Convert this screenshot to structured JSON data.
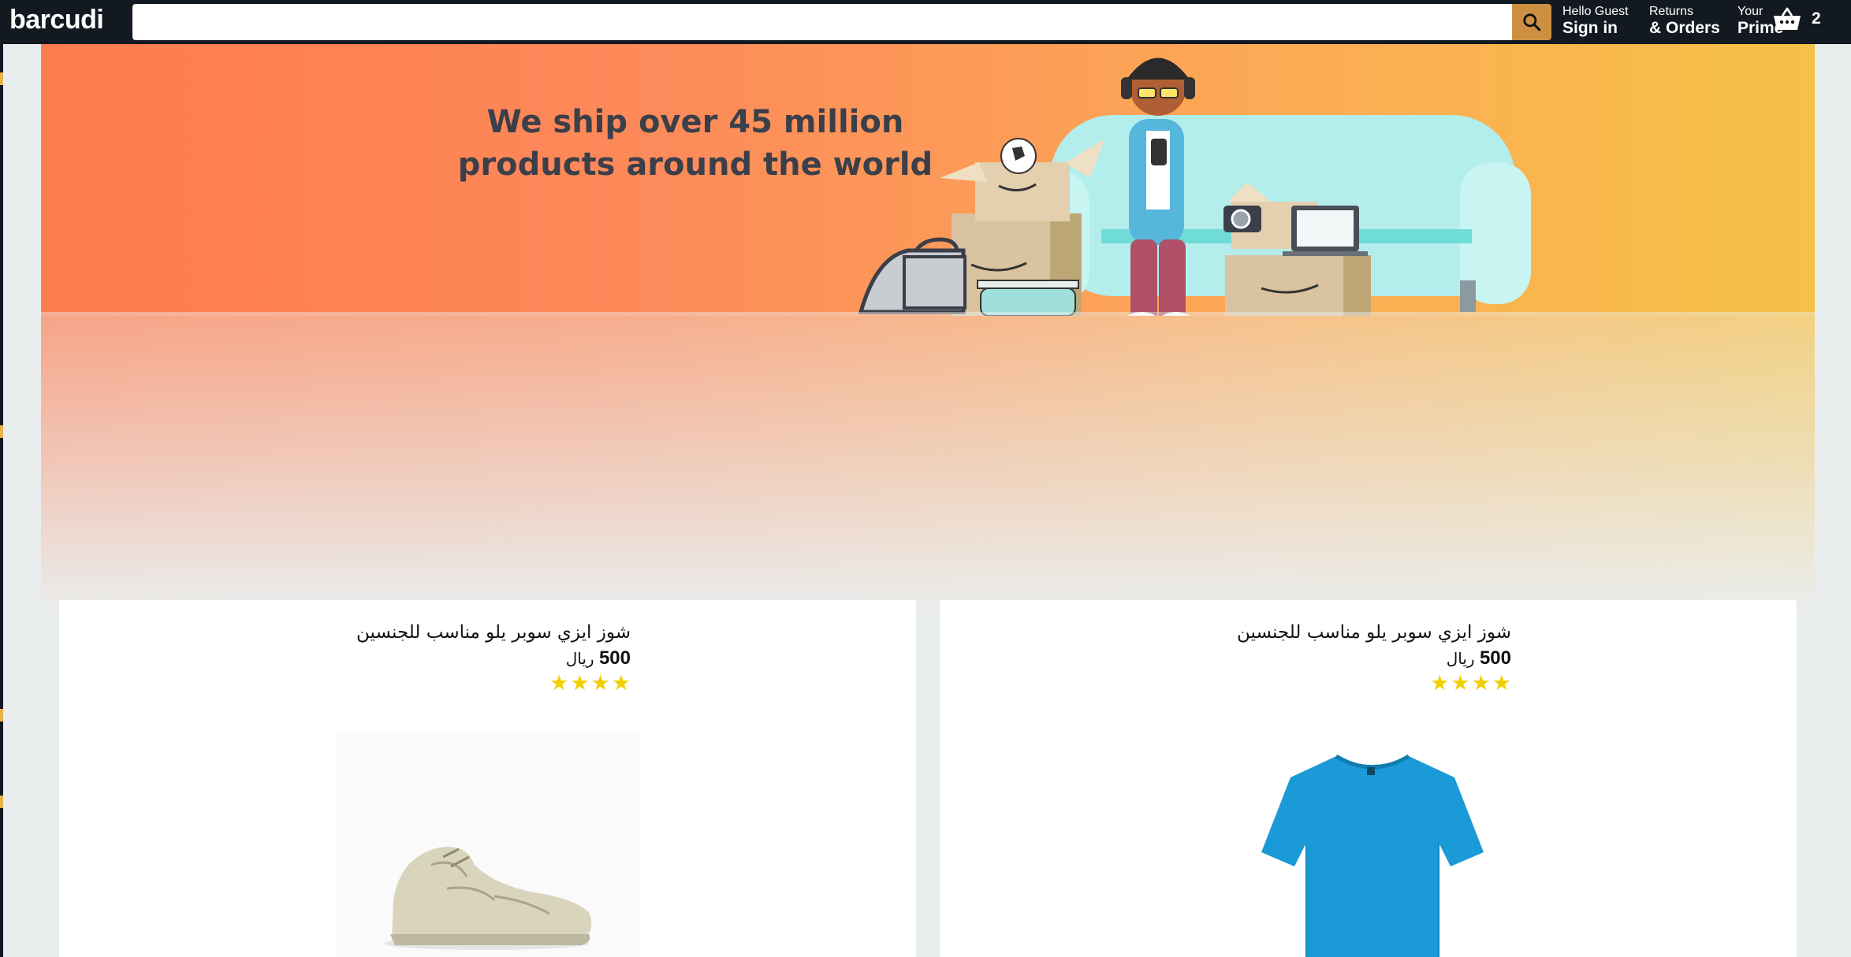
{
  "header": {
    "logo": "barcudi",
    "search": {
      "value": "",
      "placeholder": ""
    },
    "account": {
      "greeting": "Hello Guest",
      "action": "Sign in"
    },
    "orders": {
      "line1": "Returns",
      "line2": "& Orders"
    },
    "prime": {
      "line1": "Your",
      "line2": "Prime"
    },
    "cart": {
      "count": "2"
    }
  },
  "hero": {
    "headline_line1": "We ship over 45 million",
    "headline_line2": "products around the world"
  },
  "products": [
    {
      "title": "شوز ايزي سوبر يلو مناسب للجنسين",
      "price": "500",
      "currency": "ريال",
      "rating": 4,
      "image": "sneaker"
    },
    {
      "title": "شوز ايزي سوبر يلو مناسب للجنسين",
      "price": "500",
      "currency": "ريال",
      "rating": 4,
      "image": "blue-tshirt"
    }
  ],
  "colors": {
    "header_bg": "#131921",
    "search_button": "#cd9042",
    "star": "#f2d000",
    "tshirt": "#1a9ad6"
  }
}
